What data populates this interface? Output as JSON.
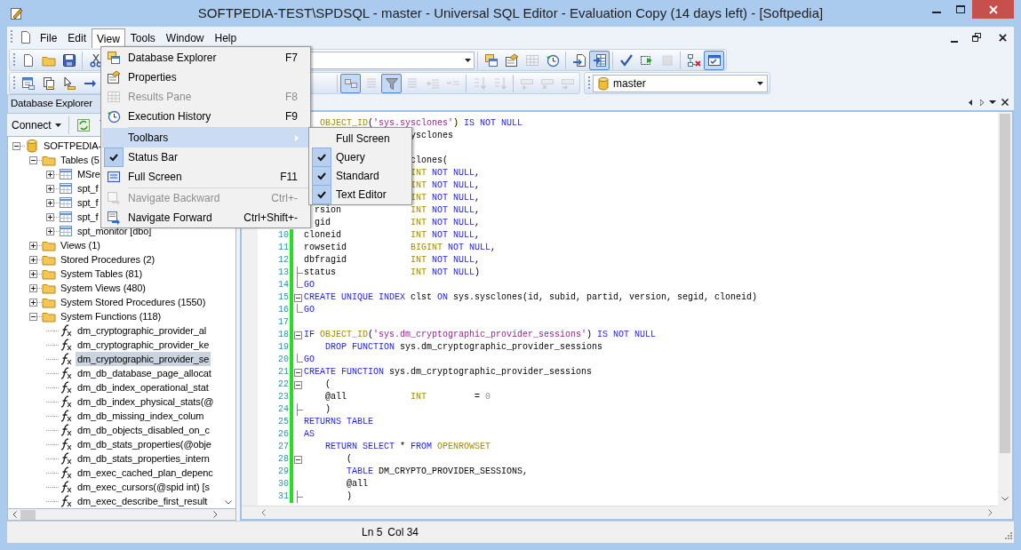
{
  "window": {
    "title": "SOFTPEDIA-TEST\\SPDSQL - master - Universal SQL Editor - Evaluation Copy (14 days left) - [Softpedia]"
  },
  "menu_bar": [
    {
      "label": "File",
      "selected": false
    },
    {
      "label": "Edit",
      "selected": false
    },
    {
      "label": "View",
      "selected": true
    },
    {
      "label": "Tools",
      "selected": false
    },
    {
      "label": "Window",
      "selected": false
    },
    {
      "label": "Help",
      "selected": false
    }
  ],
  "toolbars": {
    "standard_left": [
      {
        "pressed": false,
        "disabled": false
      },
      {
        "pressed": false,
        "disabled": false
      },
      {
        "pressed": false,
        "disabled": false
      },
      {
        "pressed": false,
        "disabled": false
      }
    ],
    "standard_right": [
      {
        "pressed": false,
        "disabled": false
      },
      {
        "pressed": false,
        "disabled": false
      },
      {
        "pressed": false,
        "disabled": true
      },
      {
        "pressed": false,
        "disabled": false
      },
      {
        "pressed": false,
        "disabled": false
      },
      {
        "pressed": true,
        "disabled": false
      },
      {
        "pressed": false,
        "disabled": false
      },
      {
        "pressed": false,
        "disabled": false
      },
      {
        "pressed": false,
        "disabled": true
      },
      {
        "pressed": false,
        "disabled": false
      },
      {
        "pressed": true,
        "disabled": false
      }
    ],
    "editor_left": [
      {
        "pressed": false,
        "disabled": false
      },
      {
        "pressed": false,
        "disabled": false
      },
      {
        "pressed": false,
        "disabled": false
      },
      {
        "pressed": false,
        "disabled": false
      }
    ],
    "editor_right": [
      {
        "pressed": true,
        "disabled": false
      },
      {
        "pressed": false,
        "disabled": true
      },
      {
        "pressed": true,
        "disabled": false
      },
      {
        "pressed": false,
        "disabled": true
      },
      {
        "pressed": false,
        "disabled": true
      },
      {
        "pressed": false,
        "disabled": true
      },
      {
        "pressed": false,
        "disabled": true
      },
      {
        "pressed": false,
        "disabled": true
      },
      {
        "pressed": false,
        "disabled": true
      },
      {
        "pressed": false,
        "disabled": true
      },
      {
        "pressed": false,
        "disabled": true
      }
    ]
  },
  "database_combo": {
    "value": "master"
  },
  "database_explorer": {
    "title": "Database Explorer",
    "connect_button": "Connect",
    "tree": [
      {
        "label": "SOFTPEDIA-",
        "kind": "database",
        "expanded": true,
        "selected": false,
        "children": [
          {
            "label": "Tables (5",
            "kind": "folder",
            "expanded": true,
            "selected": false,
            "children": [
              {
                "label": "MSre",
                "kind": "table",
                "expanded": false,
                "selected": false
              },
              {
                "label": "spt_f",
                "kind": "table",
                "expanded": false,
                "selected": false
              },
              {
                "label": "spt_f",
                "kind": "table",
                "expanded": false,
                "selected": false
              },
              {
                "label": "spt_f",
                "kind": "table",
                "expanded": false,
                "selected": false
              },
              {
                "label": "spt_monitor [dbo]",
                "kind": "table",
                "expanded": false,
                "selected": false
              }
            ]
          },
          {
            "label": "Views (1)",
            "kind": "folder",
            "expanded": false,
            "selected": false
          },
          {
            "label": "Stored Procedures (2)",
            "kind": "folder",
            "expanded": false,
            "selected": false
          },
          {
            "label": "System Tables (81)",
            "kind": "folder",
            "expanded": false,
            "selected": false
          },
          {
            "label": "System Views (480)",
            "kind": "folder",
            "expanded": false,
            "selected": false
          },
          {
            "label": "System Stored Procedures (1550)",
            "kind": "folder",
            "expanded": false,
            "selected": false
          },
          {
            "label": "System Functions (118)",
            "kind": "folder",
            "expanded": true,
            "selected": false,
            "children": [
              {
                "label": "dm_cryptographic_provider_al",
                "kind": "function",
                "selected": false
              },
              {
                "label": "dm_cryptographic_provider_ke",
                "kind": "function",
                "selected": false
              },
              {
                "label": "dm_cryptographic_provider_se",
                "kind": "function",
                "selected": true
              },
              {
                "label": "dm_db_database_page_allocat",
                "kind": "function",
                "selected": false
              },
              {
                "label": "dm_db_index_operational_stat",
                "kind": "function",
                "selected": false
              },
              {
                "label": "dm_db_index_physical_stats(@",
                "kind": "function",
                "selected": false
              },
              {
                "label": "dm_db_missing_index_colum",
                "kind": "function",
                "selected": false
              },
              {
                "label": "dm_db_objects_disabled_on_c",
                "kind": "function",
                "selected": false
              },
              {
                "label": "dm_db_stats_properties(@obje",
                "kind": "function",
                "selected": false
              },
              {
                "label": "dm_db_stats_properties_intern",
                "kind": "function",
                "selected": false
              },
              {
                "label": "dm_exec_cached_plan_depenc",
                "kind": "function",
                "selected": false
              },
              {
                "label": "dm_exec_cursors(@spid int) [s",
                "kind": "function",
                "selected": false
              },
              {
                "label": "dm_exec_describe_first_result",
                "kind": "function",
                "selected": false
              }
            ]
          }
        ]
      }
    ]
  },
  "editor": {
    "lines_top": [
      {
        "segments": [
          {
            "kind": "function",
            "text": "   OBJECT_ID"
          },
          {
            "kind": "plain",
            "text": "("
          },
          {
            "kind": "string",
            "text": "'sys.sysclones'"
          },
          {
            "kind": "plain",
            "text": ") "
          },
          {
            "kind": "keyword",
            "text": "IS NOT NULL"
          }
        ]
      },
      {
        "segments": [
          {
            "kind": "plain",
            "text": "                    ysclones"
          }
        ]
      }
    ],
    "lines": [
      {
        "segments": [
          {
            "kind": "plain",
            "text": "                    clones("
          }
        ]
      },
      {
        "segments": [
          {
            "kind": "function",
            "text": "                    INT"
          },
          {
            "kind": "keyword",
            "text": " NOT NULL"
          },
          {
            "kind": "plain",
            "text": ","
          }
        ]
      },
      {
        "segments": [
          {
            "kind": "function",
            "text": "                    INT"
          },
          {
            "kind": "keyword",
            "text": " NOT NULL"
          },
          {
            "kind": "plain",
            "text": ","
          }
        ]
      },
      {
        "segments": [
          {
            "kind": "function",
            "text": "                    INT"
          },
          {
            "kind": "keyword",
            "text": " NOT NULL"
          },
          {
            "kind": "plain",
            "text": ","
          }
        ]
      },
      {
        "segments": [
          {
            "kind": "plain",
            "text": "  rsion"
          },
          {
            "kind": "function",
            "text": "             INT"
          },
          {
            "kind": "keyword",
            "text": " NOT NULL"
          },
          {
            "kind": "plain",
            "text": ","
          }
        ]
      },
      {
        "segments": [
          {
            "kind": "plain",
            "text": "  gid"
          },
          {
            "kind": "function",
            "text": "               INT"
          },
          {
            "kind": "keyword",
            "text": " NOT NULL"
          },
          {
            "kind": "plain",
            "text": ","
          }
        ]
      },
      {
        "number": "10",
        "modified": true,
        "segments": [
          {
            "kind": "plain",
            "text": "cloneid"
          },
          {
            "kind": "function",
            "text": "             INT"
          },
          {
            "kind": "keyword",
            "text": " NOT NULL"
          },
          {
            "kind": "plain",
            "text": ","
          }
        ]
      },
      {
        "number": "11",
        "modified": true,
        "segments": [
          {
            "kind": "plain",
            "text": "rowsetid"
          },
          {
            "kind": "function",
            "text": "            BIGINT"
          },
          {
            "kind": "keyword",
            "text": " NOT NULL"
          },
          {
            "kind": "plain",
            "text": ","
          }
        ]
      },
      {
        "number": "12",
        "modified": true,
        "segments": [
          {
            "kind": "plain",
            "text": "dbfragid"
          },
          {
            "kind": "function",
            "text": "            INT"
          },
          {
            "kind": "keyword",
            "text": " NOT NULL"
          },
          {
            "kind": "plain",
            "text": ","
          }
        ]
      },
      {
        "number": "13",
        "modified": true,
        "fold_branch": true,
        "segments": [
          {
            "kind": "plain",
            "text": "status"
          },
          {
            "kind": "function",
            "text": "              INT"
          },
          {
            "kind": "keyword",
            "text": " NOT NULL"
          },
          {
            "kind": "plain",
            "text": ")"
          }
        ]
      },
      {
        "number": "14",
        "modified": true,
        "fold_end": true,
        "segments": [
          {
            "kind": "keyword",
            "text": "GO"
          }
        ]
      },
      {
        "number": "15",
        "modified": true,
        "fold_start": true,
        "segments": [
          {
            "kind": "keyword",
            "text": "CREATE UNIQUE INDEX"
          },
          {
            "kind": "plain",
            "text": " clst "
          },
          {
            "kind": "keyword",
            "text": "ON"
          },
          {
            "kind": "plain",
            "text": " sys.sysclones(id, subid, partid, version, segid, cloneid)"
          }
        ]
      },
      {
        "number": "16",
        "modified": true,
        "fold_end": true,
        "segments": [
          {
            "kind": "keyword",
            "text": "GO"
          }
        ]
      },
      {
        "number": "17",
        "modified": true
      },
      {
        "number": "18",
        "modified": true,
        "fold_start": true,
        "segments": [
          {
            "kind": "keyword",
            "text": "IF"
          },
          {
            "kind": "function",
            "text": " OBJECT_ID"
          },
          {
            "kind": "plain",
            "text": "("
          },
          {
            "kind": "string",
            "text": "'sys.dm_cryptographic_provider_sessions'"
          },
          {
            "kind": "plain",
            "text": ") "
          },
          {
            "kind": "keyword",
            "text": "IS NOT NULL"
          }
        ]
      },
      {
        "number": "19",
        "modified": true,
        "segments": [
          {
            "kind": "keyword",
            "text": "    DROP FUNCTION"
          },
          {
            "kind": "plain",
            "text": " sys.dm_cryptographic_provider_sessions"
          }
        ]
      },
      {
        "number": "20",
        "modified": true,
        "fold_end": true,
        "segments": [
          {
            "kind": "keyword",
            "text": "GO"
          }
        ]
      },
      {
        "number": "21",
        "modified": true,
        "fold_start": true,
        "segments": [
          {
            "kind": "keyword",
            "text": "CREATE FUNCTION"
          },
          {
            "kind": "plain",
            "text": " sys.dm_cryptographic_provider_sessions"
          }
        ]
      },
      {
        "number": "22",
        "modified": true,
        "fold_start": true,
        "segments": [
          {
            "kind": "plain",
            "text": "    ("
          }
        ]
      },
      {
        "number": "23",
        "modified": true,
        "segments": [
          {
            "kind": "plain",
            "text": "    @all"
          },
          {
            "kind": "function",
            "text": "            INT"
          },
          {
            "kind": "plain",
            "text": "         = "
          },
          {
            "kind": "number",
            "text": "0"
          }
        ]
      },
      {
        "number": "24",
        "modified": true,
        "fold_branch": true,
        "segments": [
          {
            "kind": "plain",
            "text": "    )"
          }
        ]
      },
      {
        "number": "25",
        "modified": true,
        "segments": [
          {
            "kind": "keyword",
            "text": "RETURNS TABLE"
          }
        ]
      },
      {
        "number": "26",
        "modified": true,
        "segments": [
          {
            "kind": "keyword",
            "text": "AS"
          }
        ]
      },
      {
        "number": "27",
        "modified": true,
        "segments": [
          {
            "kind": "keyword",
            "text": "    RETURN SELECT"
          },
          {
            "kind": "plain",
            "text": " * "
          },
          {
            "kind": "keyword",
            "text": "FROM"
          },
          {
            "kind": "function",
            "text": " OPENROWSET"
          }
        ]
      },
      {
        "number": "28",
        "modified": true,
        "fold_start": true,
        "segments": [
          {
            "kind": "plain",
            "text": "        ("
          }
        ]
      },
      {
        "number": "29",
        "modified": true,
        "segments": [
          {
            "kind": "keyword",
            "text": "        TABLE"
          },
          {
            "kind": "plain",
            "text": " DM_CRYPTO_PROVIDER_SESSIONS,"
          }
        ]
      },
      {
        "number": "30",
        "modified": true,
        "segments": [
          {
            "kind": "plain",
            "text": "        @all"
          }
        ]
      },
      {
        "number": "31",
        "modified": true,
        "fold_branch": true,
        "segments": [
          {
            "kind": "plain",
            "text": "        )"
          }
        ]
      }
    ]
  },
  "view_menu": [
    {
      "kind": "item",
      "label": "Database Explorer",
      "shortcut": "F7",
      "disabled": false,
      "checked": false,
      "selected": false,
      "submenu": false
    },
    {
      "kind": "item",
      "label": "Properties",
      "disabled": false,
      "checked": false,
      "selected": false,
      "submenu": false
    },
    {
      "kind": "item",
      "label": "Results Pane",
      "shortcut": "F8",
      "disabled": true,
      "checked": false,
      "selected": false,
      "submenu": false
    },
    {
      "kind": "item",
      "label": "Execution History",
      "shortcut": "F9",
      "disabled": false,
      "checked": false,
      "selected": false,
      "submenu": false
    },
    {
      "kind": "separator"
    },
    {
      "kind": "item",
      "label": "Toolbars",
      "disabled": false,
      "checked": false,
      "selected": true,
      "submenu": true
    },
    {
      "kind": "item",
      "label": "Status Bar",
      "disabled": false,
      "checked": true,
      "selected": false,
      "submenu": false
    },
    {
      "kind": "item",
      "label": "Full Screen",
      "shortcut": "F11",
      "disabled": false,
      "checked": false,
      "selected": false,
      "submenu": false
    },
    {
      "kind": "separator"
    },
    {
      "kind": "item",
      "label": "Navigate Backward",
      "shortcut": "Ctrl+-",
      "disabled": true,
      "checked": false,
      "selected": false,
      "submenu": false
    },
    {
      "kind": "item",
      "label": "Navigate Forward",
      "shortcut": "Ctrl+Shift+-",
      "disabled": false,
      "checked": false,
      "selected": false,
      "submenu": false
    }
  ],
  "toolbars_submenu": [
    {
      "label": "Full Screen",
      "checked": false
    },
    {
      "label": "Query",
      "checked": true
    },
    {
      "label": "Standard",
      "checked": true
    },
    {
      "label": "Text Editor",
      "checked": true
    }
  ],
  "status_bar": {
    "line": "Ln 5",
    "column": "Col 34"
  }
}
